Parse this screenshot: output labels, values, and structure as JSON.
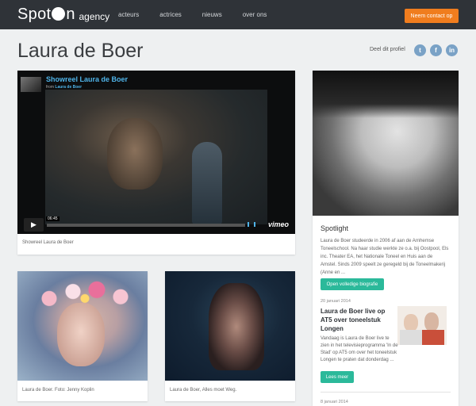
{
  "header": {
    "logo_text": "Spot",
    "logo_text_after": "n",
    "logo_suffix": "agency",
    "nav": [
      "acteurs",
      "actrices",
      "nieuws",
      "over ons"
    ],
    "contact_label": "Neem contact op",
    "accent_color": "#f07d1e",
    "bar_color": "#2f3338"
  },
  "profile": {
    "name": "Laura de Boer",
    "share_label": "Deel dit profiel",
    "social": [
      {
        "icon": "twitter-icon",
        "glyph": "t",
        "color": "#7aa2c6"
      },
      {
        "icon": "facebook-icon",
        "glyph": "f",
        "color": "#7aa2c6"
      },
      {
        "icon": "linkedin-icon",
        "glyph": "in",
        "color": "#7aa2c6"
      }
    ]
  },
  "video": {
    "title": "Showreel Laura de Boer",
    "from_label": "from",
    "from_author": "Laura de Boer",
    "time": "06:45",
    "brand": "vimeo",
    "caption": "Showreel Laura de Boer"
  },
  "photos": [
    {
      "caption": "Laura de Boer. Foto: Jenny Koplin"
    },
    {
      "caption": "Laura de Boer, Alles moet Weg."
    }
  ],
  "sidebar": {
    "spotlight_title": "Spotlight",
    "spotlight_text": "Laura de Boer studeerde in 2006 af aan de Arnhemse Toneelschool. Na haar studie werkte ze o.a. bij Oostpool, Els inc. Theater EA, het Nationale Toneel en Huis aan de Amstel. Sinds 2009 speelt ze geregeld bij de Toneelmakerij (Anne en ...",
    "bio_button": "Open volledige biografie",
    "news": [
      {
        "date": "20 januari 2014",
        "title": "Laura de Boer live op AT5 over toneelstuk Longen",
        "text": "Vandaag is Laura de Boer live te zien in het televisieprogramma 'In de Stad' op AT5 om over het toneelstuk Longen te praten dat donderdag ...",
        "more": "Lees meer"
      },
      {
        "date": "8 januari 2014"
      }
    ],
    "button_color": "#2bb99a"
  }
}
